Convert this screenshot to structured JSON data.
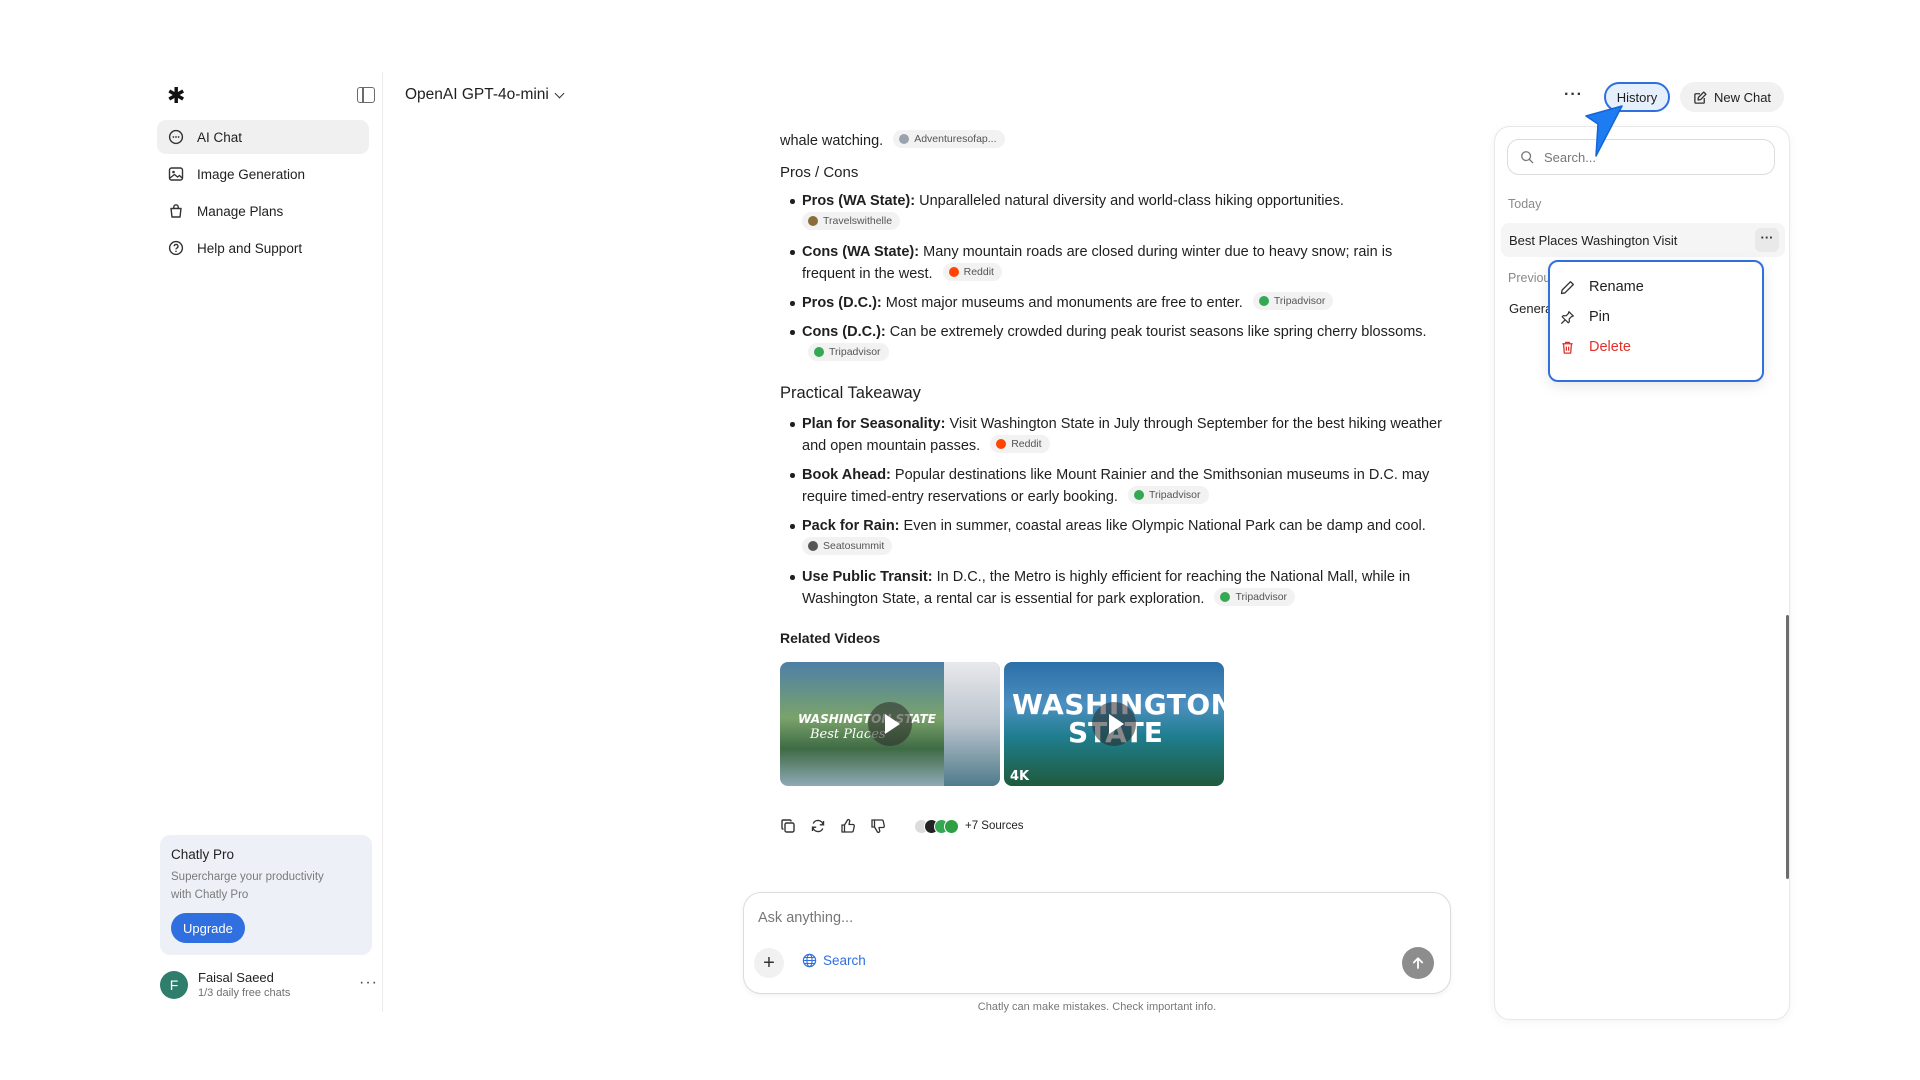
{
  "colors": {
    "accent": "#2f6fe0",
    "danger": "#e0312b",
    "upgrade": "#2f6fe0",
    "avatar": "#2f7d6b"
  },
  "sidebar": {
    "logo": "✱",
    "items": [
      {
        "label": "AI Chat",
        "icon": "chat-bubble-icon"
      },
      {
        "label": "Image Generation",
        "icon": "image-icon"
      },
      {
        "label": "Manage Plans",
        "icon": "bag-icon"
      },
      {
        "label": "Help and Support",
        "icon": "help-circle-icon"
      }
    ],
    "pro": {
      "title": "Chatly Pro",
      "subtitle": "Supercharge your productivity with Chatly Pro",
      "button": "Upgrade"
    },
    "user": {
      "initial": "F",
      "name": "Faisal Saeed",
      "quota": "1/3 daily free chats",
      "more": "···"
    }
  },
  "header": {
    "model": "OpenAI GPT-4o-mini",
    "more": "···",
    "history": "History",
    "new_chat": "New Chat"
  },
  "content": {
    "fragment": {
      "text": "whale watching.",
      "source": "Adventuresofap..."
    },
    "pros_cons_title": "Pros / Cons",
    "pros_cons": [
      {
        "label": "Pros (WA State):",
        "text": "Unparalleled natural diversity and world-class hiking opportunities.",
        "source": "Travelswithelle"
      },
      {
        "label": "Cons (WA State):",
        "text": "Many mountain roads are closed during winter due to heavy snow; rain is frequent in the west.",
        "source": "Reddit"
      },
      {
        "label": "Pros (D.C.):",
        "text": "Most major museums and monuments are free to enter.",
        "source": "Tripadvisor"
      },
      {
        "label": "Cons (D.C.):",
        "text": "Can be extremely crowded during peak tourist seasons like spring cherry blossoms.",
        "source": "Tripadvisor"
      }
    ],
    "takeaway_title": "Practical Takeaway",
    "takeaway": [
      {
        "label": "Plan for Seasonality:",
        "text": "Visit Washington State in July through September for the best hiking weather and open mountain passes.",
        "source": "Reddit"
      },
      {
        "label": "Book Ahead:",
        "text": "Popular destinations like Mount Rainier and the Smithsonian museums in D.C. may require timed-entry reservations or early booking.",
        "source": "Tripadvisor"
      },
      {
        "label": "Pack for Rain:",
        "text": "Even in summer, coastal areas like Olympic National Park can be damp and cool.",
        "source": "Seatosummit"
      },
      {
        "label": "Use Public Transit:",
        "text": "In D.C., the Metro is highly efficient for reaching the National Mall, while in Washington State, a rental car is essential for park exploration.",
        "source": "Tripadvisor"
      }
    ],
    "related_title": "Related Videos",
    "videos": [
      {
        "overlay": "WASHINGTON STATE",
        "script": "Best Places"
      },
      {
        "overlay": "WASHINGTON",
        "overlay2": "STATE",
        "badge": "4K"
      }
    ],
    "sources_label": "+7 Sources"
  },
  "composer": {
    "placeholder": "Ask anything...",
    "plus": "+",
    "search": "Search",
    "disclaimer": "Chatly can make mistakes. Check important info."
  },
  "history_panel": {
    "search_placeholder": "Search...",
    "today": "Today",
    "active_item": "Best Places Washington Visit",
    "item_more": "···",
    "previous": "Previous",
    "general": "General"
  },
  "context_menu": {
    "rename": "Rename",
    "pin": "Pin",
    "delete": "Delete"
  }
}
